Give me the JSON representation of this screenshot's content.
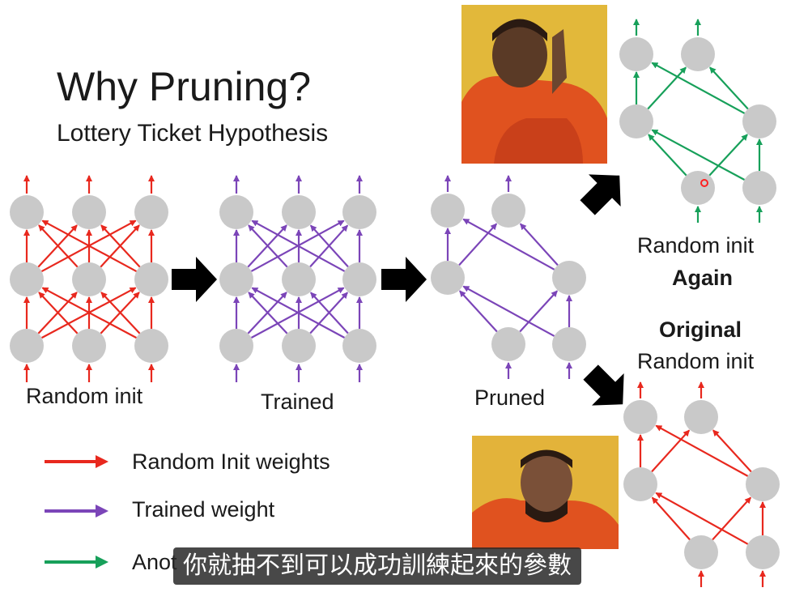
{
  "title": "Why Pruning?",
  "subtitle": "Lottery Ticket Hypothesis",
  "colors": {
    "random": "#e8281e",
    "trained": "#7b45b8",
    "another": "#17a05a",
    "node": "#c9c9c9",
    "arrow": "#000000"
  },
  "stages": {
    "random_init": "Random init",
    "trained": "Trained",
    "pruned": "Pruned"
  },
  "top_right": {
    "line1": "Random init",
    "line2": "Again"
  },
  "bottom_right": {
    "line1": "Original",
    "line2": "Random init"
  },
  "legend": [
    {
      "label": "Random Init weights",
      "color": "#e8281e"
    },
    {
      "label": "Trained weight",
      "color": "#7b45b8"
    },
    {
      "label": "Anot",
      "color": "#17a05a"
    }
  ],
  "subtitle_caption": "你就抽不到可以成功訓練起來的參數"
}
